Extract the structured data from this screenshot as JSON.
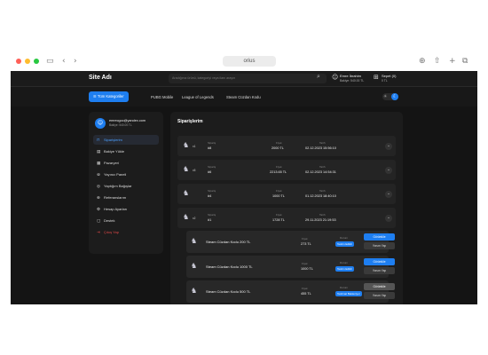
{
  "browser": {
    "url": "orius"
  },
  "header": {
    "site_name": "Site Adı",
    "search_placeholder": "Aradığınız ürünü, kategoriyi veya ilanı arayın",
    "user_name": "Emre İbrahim",
    "user_balance": "Bakiye: 540.00 TL",
    "cart_label": "Sepet (0)",
    "cart_total": "0 TL"
  },
  "categories": {
    "all_button": "Tüm Kategoriler",
    "links": [
      "PUBG Mobile",
      "League of Legends",
      "Steam Cüzdan Kodu"
    ]
  },
  "sidebar": {
    "email": "emrecgoc@yandex.com",
    "balance": "Bakiye: 540.00 TL",
    "items": [
      {
        "label": "Siparişlerim",
        "icon": "bag-icon"
      },
      {
        "label": "Bakiye Yükle",
        "icon": "wallet-icon"
      },
      {
        "label": "Pazaryeri",
        "icon": "store-icon"
      },
      {
        "label": "Yayıncı Paneli",
        "icon": "broadcast-icon"
      },
      {
        "label": "Yaptığım Bağışlar",
        "icon": "gift-icon"
      },
      {
        "label": "Referanslarım",
        "icon": "link-icon"
      },
      {
        "label": "Hesap Ayarları",
        "icon": "user-gear-icon"
      },
      {
        "label": "Destek",
        "icon": "chat-icon"
      },
      {
        "label": "Çıkış Yap",
        "icon": "logout-icon"
      }
    ]
  },
  "orders": {
    "title": "Siparişlerim",
    "list": [
      {
        "badge": "x1",
        "order_label": "Sipariş",
        "order_no": "#8",
        "price_label": "Fiyat",
        "price": "2000 TL",
        "date_label": "Tarih",
        "date": "02.12.2023 15:56:10"
      },
      {
        "badge": "x5",
        "order_label": "Sipariş",
        "order_no": "#6",
        "price_label": "Fiyat",
        "price": "2213.65 TL",
        "date_label": "Tarih",
        "date": "02.12.2023 14:54:31"
      },
      {
        "badge": "",
        "order_label": "Sipariş",
        "order_no": "#4",
        "price_label": "Fiyat",
        "price": "1000 TL",
        "date_label": "Tarih",
        "date": "01.12.2023 18:40:10"
      },
      {
        "badge": "x2",
        "order_label": "Sipariş",
        "order_no": "#1",
        "price_label": "Fiyat",
        "price": "1728 TL",
        "date_label": "Tarih",
        "date": "29.11.2023 21:19:53"
      }
    ],
    "sub_items": [
      {
        "name": "Steam Cüzdan Kodu 200 TL",
        "price_label": "Fiyat",
        "price": "273 TL",
        "status_label": "Durum",
        "status": "Teslim Edildi",
        "btn1": "Görüntüle",
        "btn2": "Yorum Yap"
      },
      {
        "name": "Steam Cüzdan Kodu 1000 TL",
        "price_label": "Fiyat",
        "price": "1000 TL",
        "status_label": "Durum",
        "status": "Teslim Edildi",
        "btn1": "Görüntüle",
        "btn2": "Yorum Yap"
      },
      {
        "name": "Steam Cüzdan Kodu 500 TL",
        "price_label": "Fiyat",
        "price": "455 TL",
        "status_label": "Durum",
        "status": "Teslimat Bekleniyor",
        "btn1": "Görüntüle",
        "btn2": "Yorum Yap"
      }
    ]
  },
  "colors": {
    "accent": "#1e7ef0",
    "background": "#141414",
    "danger": "#e04848"
  }
}
